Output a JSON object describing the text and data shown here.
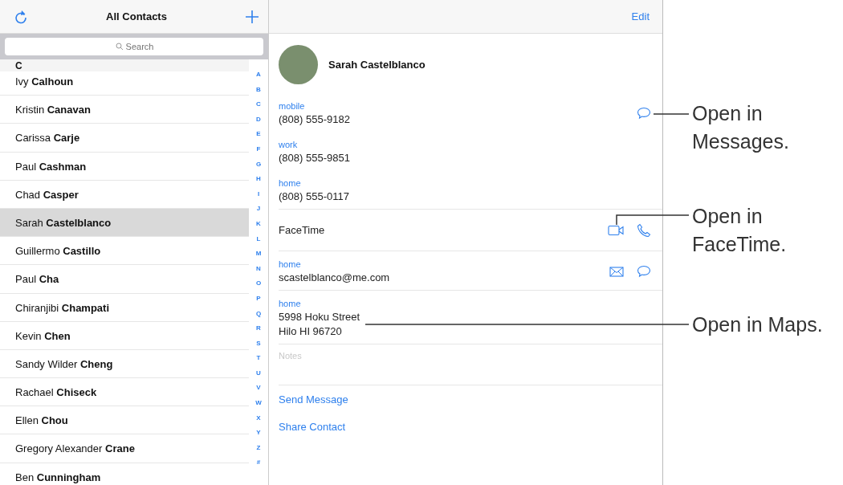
{
  "list_header": {
    "title": "All Contacts"
  },
  "search": {
    "placeholder": "Search"
  },
  "section": "C",
  "contacts": [
    {
      "first": "Ivy",
      "last": "Calhoun",
      "selected": false
    },
    {
      "first": "Kristin",
      "last": "Canavan",
      "selected": false
    },
    {
      "first": "Carissa",
      "last": "Carje",
      "selected": false
    },
    {
      "first": "Paul",
      "last": "Cashman",
      "selected": false
    },
    {
      "first": "Chad",
      "last": "Casper",
      "selected": false
    },
    {
      "first": "Sarah",
      "last": "Castelblanco",
      "selected": true
    },
    {
      "first": "Guillermo",
      "last": "Castillo",
      "selected": false
    },
    {
      "first": "Paul",
      "last": "Cha",
      "selected": false
    },
    {
      "first": "Chiranjibi",
      "last": "Champati",
      "selected": false
    },
    {
      "first": "Kevin",
      "last": "Chen",
      "selected": false
    },
    {
      "first": "Sandy Wilder",
      "last": "Cheng",
      "selected": false
    },
    {
      "first": "Rachael",
      "last": "Chiseck",
      "selected": false
    },
    {
      "first": "Ellen",
      "last": "Chou",
      "selected": false
    },
    {
      "first": "Gregory Alexander",
      "last": "Crane",
      "selected": false
    },
    {
      "first": "Ben",
      "last": "Cunningham",
      "selected": false
    }
  ],
  "index": [
    "A",
    "B",
    "C",
    "D",
    "E",
    "F",
    "G",
    "H",
    "I",
    "J",
    "K",
    "L",
    "M",
    "N",
    "O",
    "P",
    "Q",
    "R",
    "S",
    "T",
    "U",
    "V",
    "W",
    "X",
    "Y",
    "Z",
    "#"
  ],
  "detail": {
    "edit": "Edit",
    "name": "Sarah Castelblanco",
    "fields": [
      {
        "kind": "phone",
        "label": "mobile",
        "value": "(808) 555-9182",
        "messaging": true
      },
      {
        "kind": "phone",
        "label": "work",
        "value": "(808) 555-9851",
        "messaging": false
      },
      {
        "kind": "phone",
        "label": "home",
        "value": "(808) 555-0117",
        "messaging": false
      },
      {
        "kind": "facetime",
        "value": "FaceTime"
      },
      {
        "kind": "email",
        "label": "home",
        "value": "scastelblanco@me.com"
      },
      {
        "kind": "address",
        "label": "home",
        "lines": [
          "5998 Hoku Street",
          "Hilo HI 96720"
        ]
      },
      {
        "kind": "notes",
        "placeholder": "Notes"
      }
    ],
    "actions": [
      "Send Message",
      "Share Contact"
    ]
  },
  "callouts": [
    "Open in\nMessages.",
    "Open in\nFaceTime.",
    "Open in Maps."
  ]
}
